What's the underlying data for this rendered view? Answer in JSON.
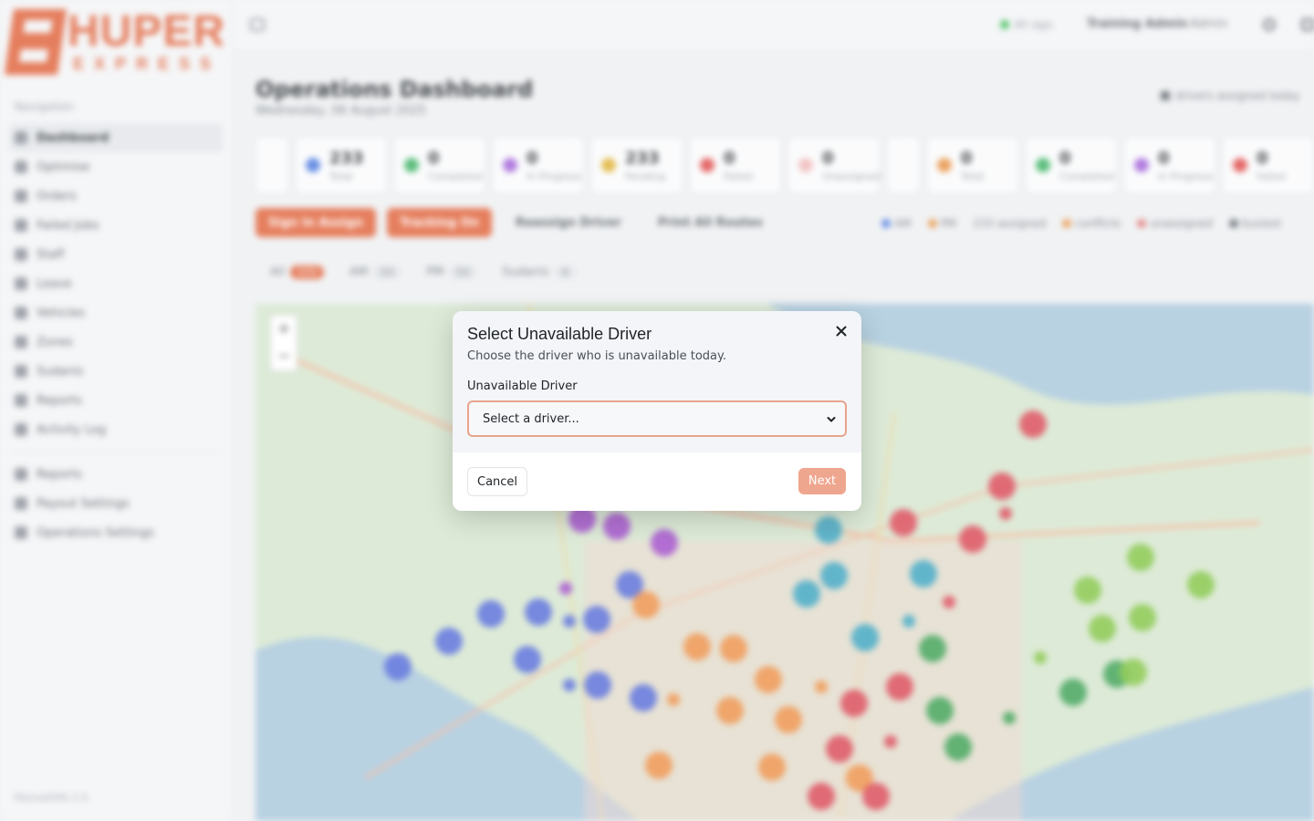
{
  "brand": {
    "logo_word": "HUPER",
    "logo_sub": "EXPRESS",
    "accent": "#e0623a"
  },
  "sidebar": {
    "section_label": "Navigation",
    "items": [
      {
        "label": "Dashboard",
        "icon": "dashboard-icon"
      },
      {
        "label": "Optimise",
        "icon": "route-icon"
      },
      {
        "label": "Orders",
        "icon": "orders-icon"
      },
      {
        "label": "Failed Jobs",
        "icon": "alert-icon"
      },
      {
        "label": "Staff",
        "icon": "user-icon"
      },
      {
        "label": "Leave",
        "icon": "calendar-icon"
      },
      {
        "label": "Vehicles",
        "icon": "truck-icon"
      },
      {
        "label": "Zones",
        "icon": "map-pin-icon"
      },
      {
        "label": "Sudanis",
        "icon": "group-icon"
      },
      {
        "label": "Reports",
        "icon": "chart-icon"
      },
      {
        "label": "Activity Log",
        "icon": "list-icon"
      }
    ],
    "secondary_items": [
      {
        "label": "Reports",
        "icon": "report-icon"
      },
      {
        "label": "Payout Settings",
        "icon": "dollar-icon"
      },
      {
        "label": "Operations Settings",
        "icon": "settings-icon"
      }
    ],
    "version": "MainwEMA 2.0"
  },
  "topbar": {
    "sync_status": "6h ago",
    "user_name": "Training Admin",
    "user_role": "Admin"
  },
  "header": {
    "title": "Operations Dashboard",
    "date": "Wednesday, 06 August 2025",
    "drivers_note": "drivers assigned today"
  },
  "stats": [
    {
      "value": "233",
      "label": "Total",
      "color": "#4a78e0"
    },
    {
      "value": "0",
      "label": "Completed",
      "color": "#39b060"
    },
    {
      "value": "0",
      "label": "In Progress",
      "color": "#a060d8"
    },
    {
      "value": "233",
      "label": "Pending",
      "color": "#e0b030"
    },
    {
      "value": "0",
      "label": "Failed",
      "color": "#e04848"
    },
    {
      "value": "0",
      "label": "Unassigned",
      "color": "#f0b8b8"
    },
    {
      "value": "0",
      "label": "Total",
      "color": "#e89040"
    },
    {
      "value": "0",
      "label": "Completed",
      "color": "#39b060"
    },
    {
      "value": "0",
      "label": "In Progress",
      "color": "#a060d8"
    },
    {
      "value": "0",
      "label": "Failed",
      "color": "#e04848"
    }
  ],
  "actions": {
    "auto_assign": "Sign In Assign",
    "tracking": "Tracking On",
    "reassign": "Reassign Driver",
    "print": "Print All Routes"
  },
  "legend": [
    {
      "label": "AM",
      "color": "#4a78e0"
    },
    {
      "label": "PM",
      "color": "#e89040"
    },
    {
      "label": "233 assigned",
      "color": ""
    },
    {
      "label": "conflicts",
      "color": "#e89040"
    },
    {
      "label": "unassigned",
      "color": "#e07070"
    },
    {
      "label": "busiest",
      "color": "#5a6068"
    }
  ],
  "tabs": [
    {
      "label": "All",
      "count": "233",
      "active": true
    },
    {
      "label": "AM",
      "count": "53",
      "active": false
    },
    {
      "label": "PM",
      "count": "53",
      "active": false
    },
    {
      "label": "Sudanis",
      "count": "4",
      "active": false
    }
  ],
  "map": {
    "zoom_in": "+",
    "zoom_out": "−"
  },
  "modal": {
    "title": "Select Unavailable Driver",
    "subtitle": "Choose the driver who is unavailable today.",
    "field_label": "Unavailable Driver",
    "select_value": "Select a driver...",
    "cancel_label": "Cancel",
    "next_label": "Next"
  }
}
